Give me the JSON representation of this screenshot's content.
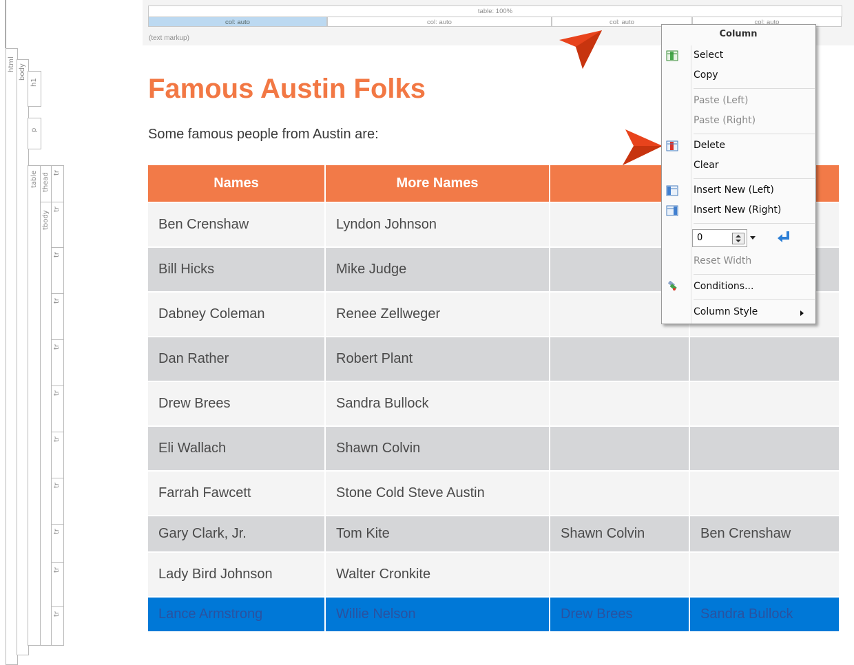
{
  "structure": {
    "labels": [
      "html",
      "body",
      "h1",
      "p",
      "table",
      "thead",
      "tr",
      "tbody",
      "tr",
      "tr",
      "tr",
      "tr",
      "tr",
      "tr",
      "tr",
      "tr",
      "tr",
      "tr"
    ]
  },
  "column_bar": {
    "table_label": "table: 100%",
    "cols": [
      "col: auto",
      "col: auto",
      "col: auto",
      "col: auto"
    ],
    "markup_label": "(text markup)"
  },
  "page": {
    "title": "Famous Austin Folks",
    "intro": "Some famous people from Austin are:"
  },
  "table": {
    "headers": [
      "Names",
      "More Names",
      "",
      ""
    ],
    "rows": [
      [
        "Ben Crenshaw",
        "Lyndon Johnson",
        "",
        ""
      ],
      [
        "Bill Hicks",
        "Mike Judge",
        "",
        ""
      ],
      [
        "Dabney Coleman",
        "Renee Zellweger",
        "",
        ""
      ],
      [
        "Dan Rather",
        "Robert Plant",
        "",
        ""
      ],
      [
        "Drew Brees",
        "Sandra Bullock",
        "",
        ""
      ],
      [
        "Eli Wallach",
        "Shawn Colvin",
        "",
        ""
      ],
      [
        "Farrah Fawcett",
        "Stone Cold Steve Austin",
        "",
        ""
      ],
      [
        "Gary Clark, Jr.",
        "Tom Kite",
        "Shawn Colvin",
        "Ben Crenshaw"
      ],
      [
        "Lady Bird Johnson",
        "Walter Cronkite",
        "",
        ""
      ],
      [
        "Lance Armstrong",
        "Willie Nelson",
        "Drew Brees",
        "Sandra Bullock"
      ]
    ]
  },
  "menu": {
    "title": "Column",
    "select": "Select",
    "copy": "Copy",
    "paste_left": "Paste (Left)",
    "paste_right": "Paste (Right)",
    "delete": "Delete",
    "clear": "Clear",
    "insert_left": "Insert New (Left)",
    "insert_right": "Insert New (Right)",
    "width_value": "0",
    "reset_width": "Reset Width",
    "conditions": "Conditions...",
    "column_style": "Column Style"
  },
  "colors": {
    "accent": "#f27844",
    "header_bg": "#f27a48",
    "selected_row": "#0078d7",
    "callout": "#e8431c"
  },
  "icons": [
    "select-column-icon",
    "delete-column-icon",
    "insert-left-icon",
    "insert-right-icon",
    "apply-enter-icon",
    "conditions-icon",
    "submenu-arrow-icon"
  ]
}
